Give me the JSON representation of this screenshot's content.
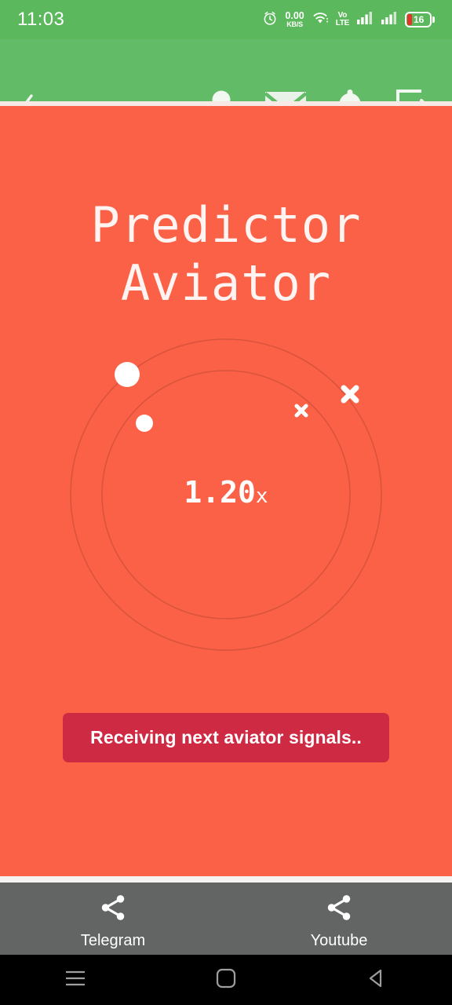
{
  "status_bar": {
    "time": "11:03",
    "alarm_icon": "alarm-clock-icon",
    "network_speed_value": "0.00",
    "network_speed_unit": "KB/S",
    "wifi_icon": "wifi-icon",
    "volte_top": "Vo",
    "volte_bottom": "LTE",
    "signal_icon_1": "signal-bars-icon",
    "signal_icon_2": "signal-bars-icon",
    "battery_level": "16",
    "battery_icon": "battery-icon"
  },
  "header": {
    "back_icon": "chevron-left-icon",
    "actions": [
      {
        "name": "profile-icon",
        "label": "Profile"
      },
      {
        "name": "mail-icon",
        "label": "Mail"
      },
      {
        "name": "bell-icon",
        "label": "Notifications"
      },
      {
        "name": "logout-icon",
        "label": "Logout"
      }
    ],
    "background_color": "#62BC67"
  },
  "main": {
    "background_color": "#FB6147",
    "title_line1": "Predictor",
    "title_line2": "Aviator",
    "multiplier_value": "1.20",
    "multiplier_suffix": "x",
    "button_label": "Receiving next aviator signals..",
    "button_color": "#CF2A43",
    "orbit": {
      "stroke_color": "#D9543C",
      "marker_color": "#FFFFFF",
      "outer_radius": 198,
      "inner_radius": 158,
      "markers": [
        {
          "type": "dot",
          "orbit": "outer",
          "radius": 16
        },
        {
          "type": "dot",
          "orbit": "inner",
          "radius": 11
        },
        {
          "type": "cross",
          "orbit": "outer",
          "size": 14
        },
        {
          "type": "cross",
          "orbit": "inner",
          "size": 9
        }
      ]
    }
  },
  "footer": {
    "background_color": "#636464",
    "items": [
      {
        "icon": "share-icon",
        "label": "Telegram"
      },
      {
        "icon": "share-icon",
        "label": "Youtube"
      }
    ]
  },
  "nav_bar": {
    "recents_icon": "recents-menu-icon",
    "home_icon": "home-square-icon",
    "back_icon": "back-triangle-icon"
  }
}
